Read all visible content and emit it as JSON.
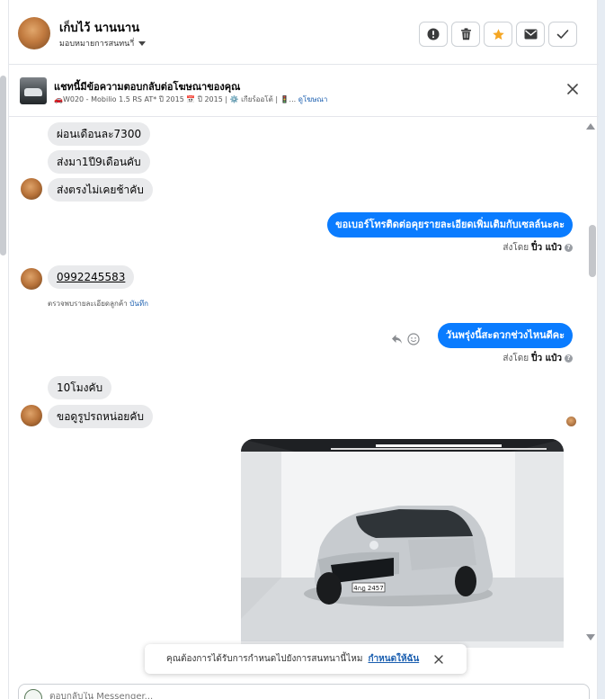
{
  "header": {
    "contact_name": "เก็บไว้ นานนาน",
    "assign_label": "มอบหมายการสนทนาี่"
  },
  "header_actions": [
    "report-icon",
    "trash-icon",
    "star-icon",
    "envelope-icon",
    "check-icon"
  ],
  "ad_banner": {
    "title": "แชทนี้มีข้อความตอบกลับต่อโฆษณาของคุณ",
    "details": "🚗W020 - Mobilio 1.5 RS AT* ปี 2015 📅 ปี 2015 | ⚙️ เกียร์ออโต้ | 🚦...",
    "view_ad_link": "ดูโฆษณา"
  },
  "messages": [
    {
      "id": "m1",
      "direction": "in",
      "text": "ผ่อนเดือนละ7300"
    },
    {
      "id": "m2",
      "direction": "in",
      "text": "ส่งมา1ปี9เดือนคับ"
    },
    {
      "id": "m3",
      "direction": "in",
      "text": "ส่งตรงไม่เคยช้าคับ"
    },
    {
      "id": "m4",
      "direction": "out",
      "text": "ขอเบอร์โทรติดต่อคุยรายละเอียดเพิ่มเติมกับเซลล์นะคะ",
      "sent_by_label": "ส่งโดย",
      "sender": "ปิ๋ว แป๋ว"
    },
    {
      "id": "m5",
      "direction": "in",
      "text": "0992245583",
      "note": "ตรวจพบรายละเอียดลูกค้า",
      "note_link": "บันทึก"
    },
    {
      "id": "m6",
      "direction": "out",
      "text": "วันพรุ่งนี้สะดวกช่วงไหนดีคะ",
      "sent_by_label": "ส่งโดย",
      "sender": "ปิ๋ว แป๋ว"
    },
    {
      "id": "m7",
      "direction": "in",
      "text": "10โมงคับ"
    },
    {
      "id": "m8",
      "direction": "in",
      "text": "ขอดูรูปรถหน่อยคับ"
    }
  ],
  "car_photo": {
    "plate": "4กฎ 2457",
    "colors": {
      "wall": "#f1f2f3",
      "floor": "#d9dcde",
      "car_body": "#c7cbcf",
      "ceiling": "#2b2d30"
    }
  },
  "toast": {
    "text": "คุณต้องการได้รับการกำหนดไปยังการสนทนานี้ไหม",
    "action_label": "กำหนดให้ฉัน"
  },
  "composer": {
    "placeholder": "ตอบกลับใน Messenger..."
  },
  "colors": {
    "accent": "#0a7cff",
    "incoming_bubble": "#e9eaec",
    "star": "#f5a623",
    "link": "#1b5fb0"
  }
}
